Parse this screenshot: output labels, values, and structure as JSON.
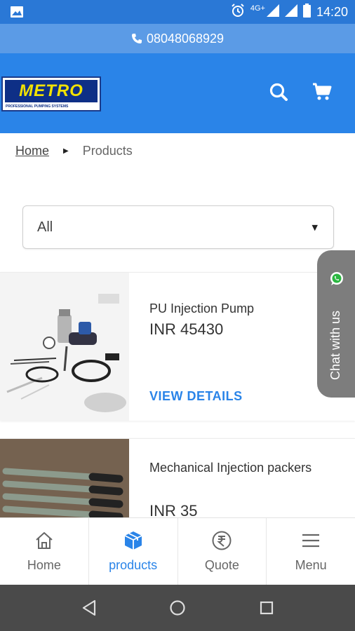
{
  "status_bar": {
    "network": "4G+",
    "time": "14:20",
    "icons": [
      "image-icon",
      "alarm-icon",
      "signal-icon",
      "wifi-icon",
      "battery-icon"
    ]
  },
  "phone_bar": {
    "phone": "08048068929",
    "icon": "phone-icon"
  },
  "header": {
    "logo_text": "METRO",
    "logo_tagline": "PROFESSIONAL PUMPING SYSTEMS",
    "search_icon": "search-icon",
    "cart_icon": "cart-icon"
  },
  "breadcrumb": {
    "home": "Home",
    "current": "Products"
  },
  "filter": {
    "selected": "All"
  },
  "products": [
    {
      "title": "PU Injection Pump",
      "price": "INR 45430",
      "link": "VIEW DETAILS"
    },
    {
      "title": "Mechanical Injection packers",
      "price": "INR 35"
    }
  ],
  "chat": {
    "label": "Chat with us",
    "icon": "whatsapp-icon"
  },
  "bottom_nav": [
    {
      "label": "Home",
      "icon": "home-icon",
      "active": false
    },
    {
      "label": "products",
      "icon": "box-icon",
      "active": true
    },
    {
      "label": "Quote",
      "icon": "rupee-icon",
      "active": false
    },
    {
      "label": "Menu",
      "icon": "menu-icon",
      "active": false
    }
  ],
  "colors": {
    "primary": "#2a84e8",
    "phone_bar": "#5b9be6",
    "status_bar": "#2a78d6",
    "chat_tab": "#7d7d7d",
    "system_nav": "#4a4a4a"
  }
}
